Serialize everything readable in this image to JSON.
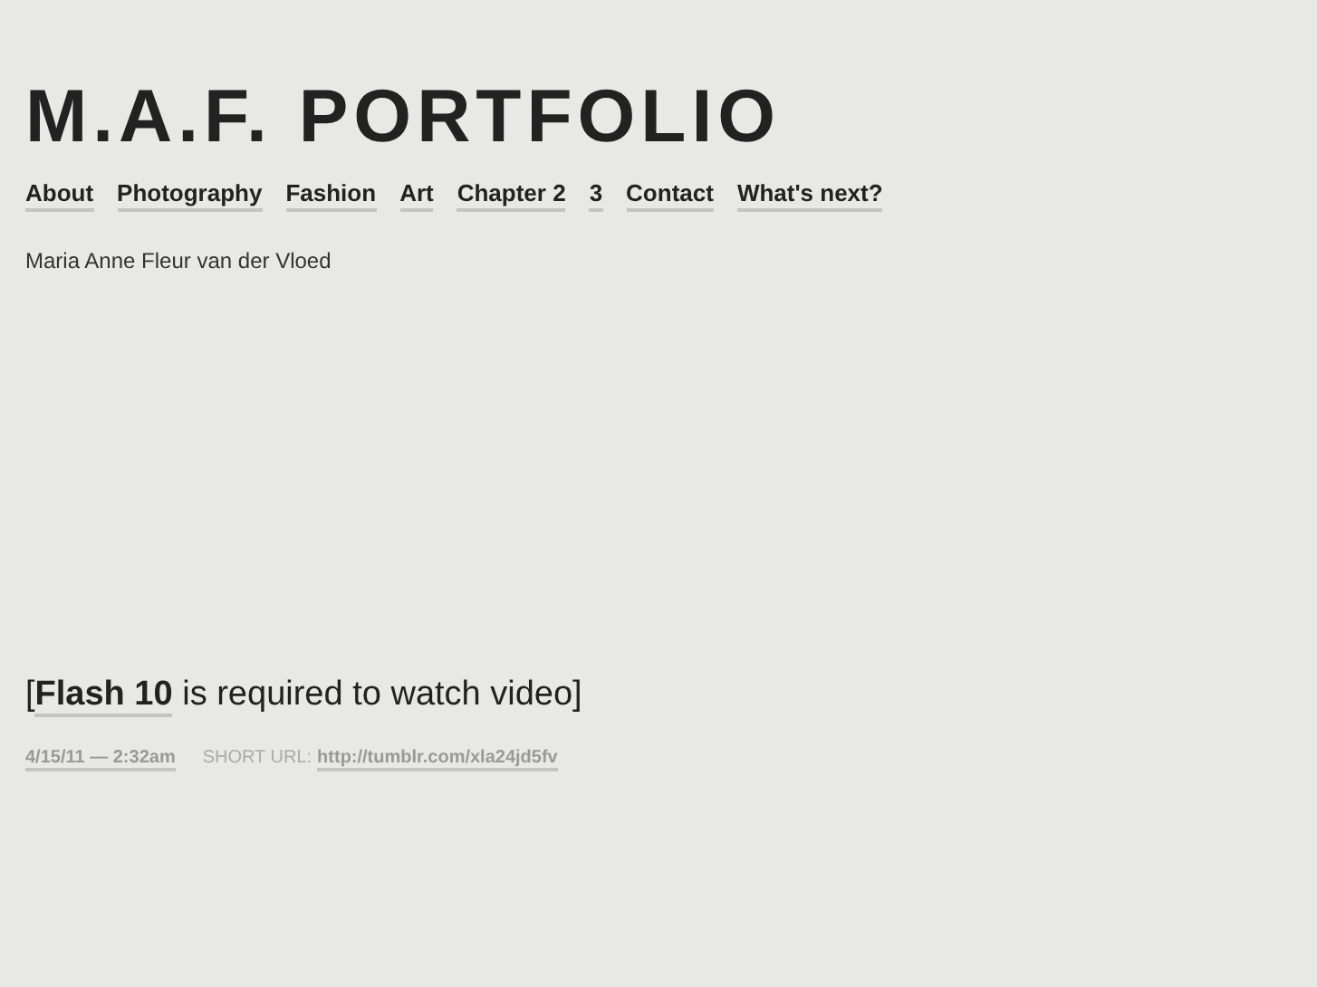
{
  "site_title": "M.A.F. PORTFOLIO",
  "nav": [
    {
      "label": "About"
    },
    {
      "label": "Photography"
    },
    {
      "label": "Fashion"
    },
    {
      "label": "Art"
    },
    {
      "label": "Chapter 2"
    },
    {
      "label": "3"
    },
    {
      "label": "Contact"
    },
    {
      "label": "What's next?"
    }
  ],
  "description": "Maria Anne Fleur van der Vloed",
  "video_notice": {
    "before": "[",
    "link": "Flash 10",
    "after": " is required to watch video]"
  },
  "post_meta": {
    "date": "4/15/11 — 2:32am",
    "short_url_label": "SHORT URL:",
    "short_url": "http://tumblr.com/xla24jd5fv"
  }
}
